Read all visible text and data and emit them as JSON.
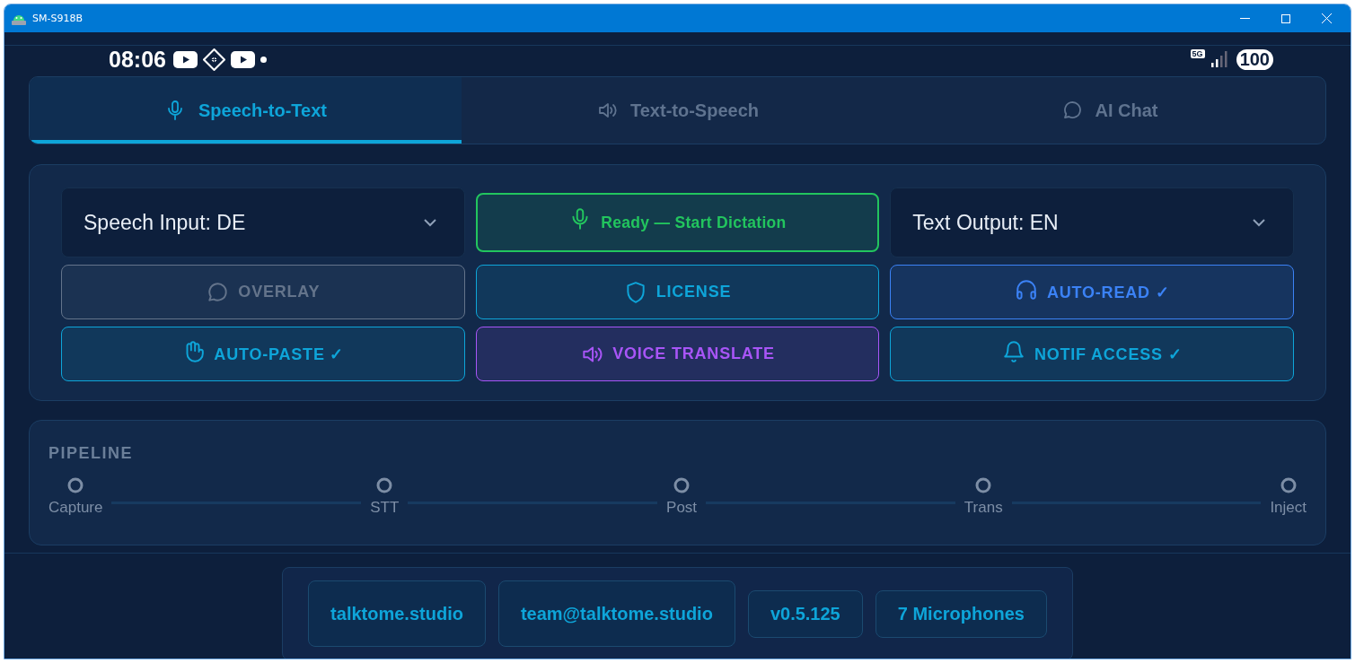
{
  "window": {
    "title": "SM-S918B"
  },
  "status_bar": {
    "time": "08:06",
    "network": "5G",
    "battery": "100"
  },
  "tabs": [
    {
      "label": "Speech-to-Text",
      "selected": true
    },
    {
      "label": "Text-to-Speech",
      "selected": false
    },
    {
      "label": "AI Chat",
      "selected": false
    }
  ],
  "controls": [
    {
      "kind": "dropdown",
      "label": "Speech Input: DE"
    },
    {
      "kind": "button",
      "label": "Ready — Start Dictation",
      "color": "#22c55e"
    },
    {
      "kind": "dropdown",
      "label": "Text Output: EN"
    },
    {
      "kind": "button",
      "label": "OVERLAY",
      "color": "#64748b"
    },
    {
      "kind": "button",
      "label": "LICENSE",
      "color": "#0ea5d9"
    },
    {
      "kind": "button",
      "label": "AUTO-READ ✓",
      "color": "#3b82f6"
    },
    {
      "kind": "button",
      "label": "AUTO-PASTE ✓",
      "color": "#0ea5d9"
    },
    {
      "kind": "button",
      "label": "VOICE TRANSLATE",
      "color": "#a855f7"
    },
    {
      "kind": "button",
      "label": "NOTIF ACCESS ✓",
      "color": "#0ea5d9"
    }
  ],
  "pipeline": {
    "title": "PIPELINE",
    "steps": [
      "Capture",
      "STT",
      "Post",
      "Trans",
      "Inject"
    ]
  },
  "footer": [
    {
      "kind": "link",
      "label": "talktome.studio"
    },
    {
      "kind": "link",
      "label": "team@talktome.studio"
    },
    {
      "kind": "badge",
      "label": "v0.5.125"
    },
    {
      "kind": "badge",
      "label": "7 Microphones"
    }
  ]
}
